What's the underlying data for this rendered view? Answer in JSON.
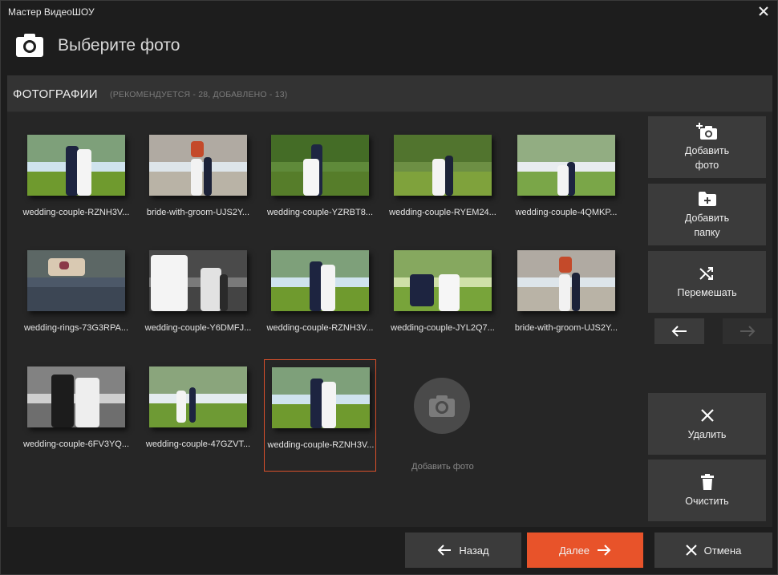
{
  "window": {
    "title": "Мастер ВидеоШОУ"
  },
  "header": {
    "title": "Выберите фото",
    "icon": "camera-icon"
  },
  "panel": {
    "title": "ФОТОГРАФИИ",
    "subtitle": "(РЕКОМЕНДУЕТСЯ - 28, ДОБАВЛЕНО - 13)"
  },
  "photos": [
    {
      "name": "wedding-couple-RZNH3V...",
      "scene": "couple-field"
    },
    {
      "name": "bride-with-groom-UJS2Y...",
      "scene": "church"
    },
    {
      "name": "wedding-couple-YZRBT8...",
      "scene": "couple-green"
    },
    {
      "name": "wedding-couple-RYEM24...",
      "scene": "couple-wide"
    },
    {
      "name": "wedding-couple-4QMKP...",
      "scene": "couple-house"
    },
    {
      "name": "wedding-rings-73G3RPA...",
      "scene": "rings"
    },
    {
      "name": "wedding-couple-Y6DMFJ...",
      "scene": "bw-closeup"
    },
    {
      "name": "wedding-couple-RZNH3V...",
      "scene": "couple-field"
    },
    {
      "name": "wedding-couple-JYL2Q7...",
      "scene": "couple-sitting"
    },
    {
      "name": "bride-with-groom-UJS2Y...",
      "scene": "church"
    },
    {
      "name": "wedding-couple-6FV3YQ...",
      "scene": "bw-portrait"
    },
    {
      "name": "wedding-couple-47GZVT...",
      "scene": "walk"
    },
    {
      "name": "wedding-couple-RZNH3V...",
      "scene": "couple-field"
    }
  ],
  "selected_index": 12,
  "add_photo_tile": {
    "label": "Добавить фото"
  },
  "sidebar": {
    "add_photo": "Добавить фото",
    "add_folder": "Добавить папку",
    "shuffle": "Перемешать",
    "delete": "Удалить",
    "clear": "Очистить"
  },
  "footer": {
    "back": "Назад",
    "next": "Далее",
    "cancel": "Отмена"
  },
  "colors": {
    "accent": "#e8532a",
    "selection": "#d9502b",
    "button": "#3b3b3b"
  }
}
